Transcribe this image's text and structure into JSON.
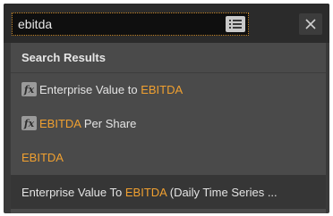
{
  "search": {
    "value": "ebitda",
    "placeholder": ""
  },
  "icons": {
    "list_toggle": "list-icon",
    "close": "close-icon",
    "function": "fx-icon"
  },
  "colors": {
    "highlight": "#f0a030",
    "search_border": "#c98a2d",
    "panel_bg": "#3a3a3a",
    "results_bg": "#4a4a4a",
    "selected_row_bg": "#363636"
  },
  "results": {
    "header": "Search Results",
    "items": [
      {
        "icon": "fx",
        "before": "Enterprise Value to ",
        "match": "EBITDA",
        "after": ""
      },
      {
        "icon": "fx",
        "before": "",
        "match": "EBITDA",
        "after": " Per Share"
      },
      {
        "icon": "",
        "before": "",
        "match": "EBITDA",
        "after": ""
      },
      {
        "icon": "",
        "before": "Enterprise Value To ",
        "match": "EBITDA",
        "after": " (Daily Time Series ..."
      }
    ]
  }
}
